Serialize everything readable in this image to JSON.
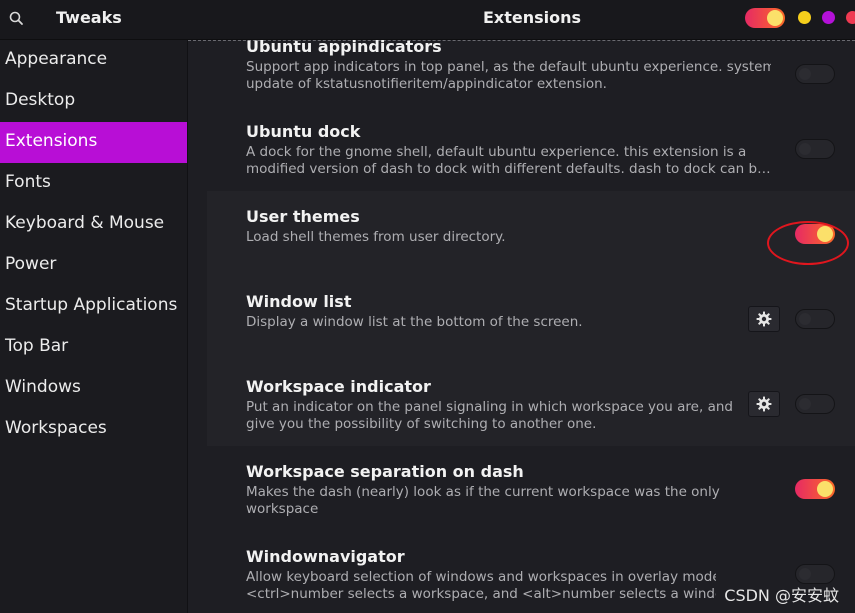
{
  "header": {
    "app_title": "Tweaks",
    "page_title": "Extensions",
    "search_icon": "search-icon",
    "window_controls": [
      "minimize",
      "maximize",
      "close"
    ]
  },
  "colors": {
    "accent": "#b80ed6",
    "switch_on": "#fb6a28",
    "knob_on": "#fbe06a",
    "highlight": "#e0161e"
  },
  "sidebar": {
    "items": [
      {
        "label": "Appearance"
      },
      {
        "label": "Desktop"
      },
      {
        "label": "Extensions",
        "active": true
      },
      {
        "label": "Fonts"
      },
      {
        "label": "Keyboard & Mouse"
      },
      {
        "label": "Power"
      },
      {
        "label": "Startup Applications"
      },
      {
        "label": "Top Bar"
      },
      {
        "label": "Windows"
      },
      {
        "label": "Workspaces"
      }
    ]
  },
  "extensions": [
    {
      "title": "Ubuntu appindicators",
      "desc": [
        "Support app indicators in top panel, as the default ubuntu experience. system",
        "update of kstatusnotifieritem/appindicator extension."
      ],
      "enabled": false
    },
    {
      "title": "Ubuntu dock",
      "desc": [
        "A dock for the gnome shell, default ubuntu experience. this extension is a",
        "modified version of dash to dock with different defaults. dash to dock can b…"
      ],
      "enabled": false
    },
    {
      "title": "User themes",
      "desc": [
        "Load shell themes from user directory."
      ],
      "enabled": true,
      "highlighted": true
    },
    {
      "title": "Window list",
      "desc": [
        "Display a window list at the bottom of the screen."
      ],
      "enabled": false,
      "has_settings": true
    },
    {
      "title": "Workspace indicator",
      "desc": [
        "Put an indicator on the panel signaling in which workspace you are, and",
        "give you the possibility of switching to another one."
      ],
      "enabled": false,
      "has_settings": true
    },
    {
      "title": "Workspace separation on dash",
      "desc": [
        "Makes the dash (nearly) look as if the current workspace was the only",
        "workspace"
      ],
      "enabled": true
    },
    {
      "title": "Windownavigator",
      "desc": [
        "Allow keyboard selection of windows and workspaces in overlay mode.",
        "<ctrl>number selects a workspace, and <alt>number selects a window."
      ],
      "enabled": false
    }
  ],
  "watermark": "CSDN @安安蚊"
}
